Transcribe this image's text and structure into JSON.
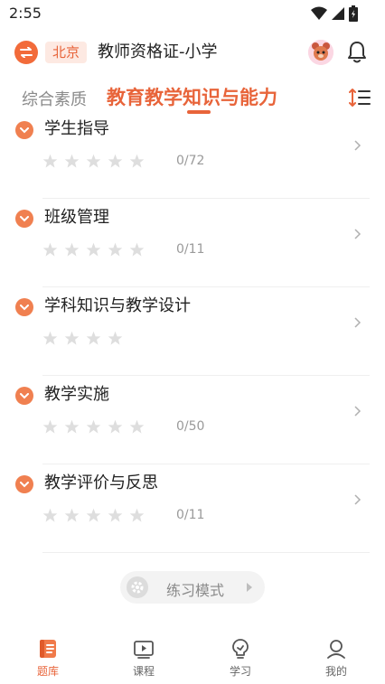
{
  "status_bar": {
    "time": "2:55"
  },
  "header": {
    "city": "北京",
    "exam_title": "教师资格证-小学"
  },
  "tabs": [
    {
      "label": "综合素质",
      "active": false
    },
    {
      "label": "教育教学知识与能力",
      "active": true
    }
  ],
  "chapters": [
    {
      "title": "学生指导",
      "progress": "0/72"
    },
    {
      "title": "班级管理",
      "progress": "0/11"
    },
    {
      "title": "学科知识与教学设计",
      "progress": ""
    },
    {
      "title": "教学实施",
      "progress": "0/50"
    },
    {
      "title": "教学评价与反思",
      "progress": "0/11"
    }
  ],
  "practice": {
    "label": "练习模式"
  },
  "bottom_nav": [
    {
      "label": "题库",
      "icon": "question-bank-icon",
      "active": true
    },
    {
      "label": "课程",
      "icon": "course-play-icon",
      "active": false
    },
    {
      "label": "学习",
      "icon": "study-bulb-icon",
      "active": false
    },
    {
      "label": "我的",
      "icon": "profile-icon",
      "active": false
    }
  ],
  "colors": {
    "accent": "#e8643a",
    "star": "#dedede"
  }
}
